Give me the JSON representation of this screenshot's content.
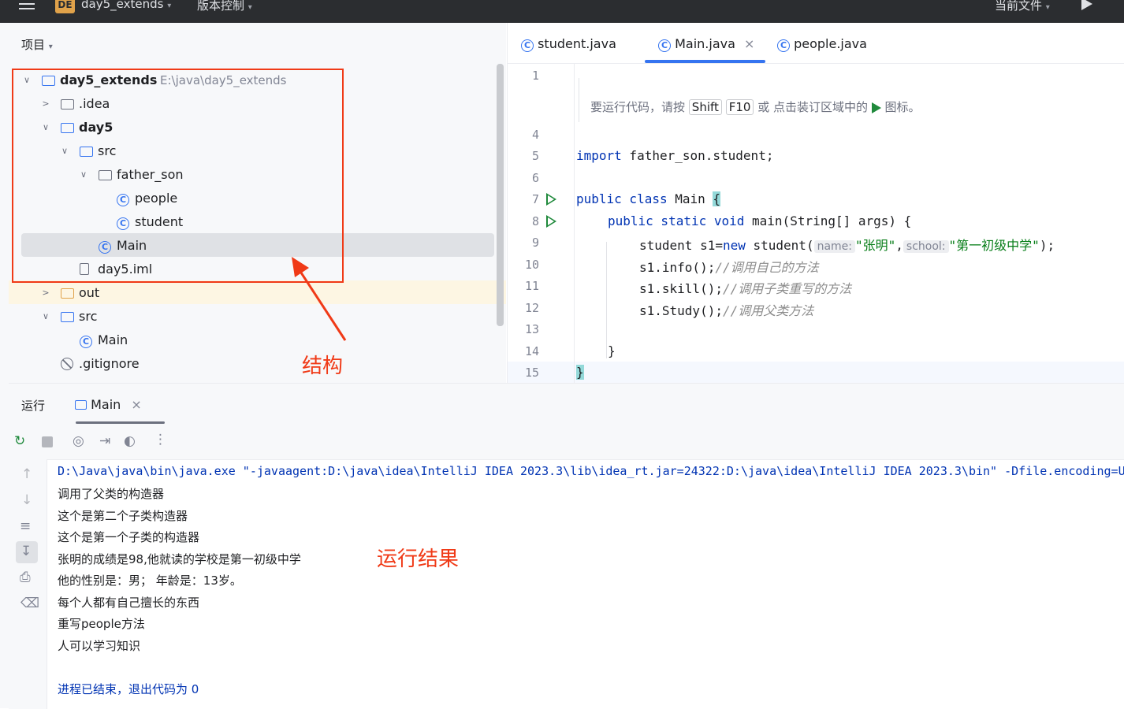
{
  "titlebar": {
    "badge": "DE",
    "project": "day5_extends",
    "vcs": "版本控制",
    "run_config": "当前文件",
    "menu_icon": "hamburger-icon",
    "run_icon": "play-icon"
  },
  "project_panel": {
    "header": "项目",
    "tree": [
      {
        "label": "day5_extends",
        "path": "E:\\java\\day5_extends",
        "expanded": true
      },
      {
        "label": ".idea",
        "expanded": false
      },
      {
        "label": "day5",
        "expanded": true
      },
      {
        "label": "src",
        "expanded": true
      },
      {
        "label": "father_son",
        "expanded": true
      },
      {
        "label": "people"
      },
      {
        "label": "student"
      },
      {
        "label": "Main",
        "selected": true
      },
      {
        "label": "day5.iml"
      },
      {
        "label": "out",
        "expanded": false
      },
      {
        "label": "src",
        "expanded": true
      },
      {
        "label": "Main"
      },
      {
        "label": ".gitignore"
      }
    ]
  },
  "editor": {
    "tabs": [
      {
        "label": "student.java"
      },
      {
        "label": "Main.java",
        "active": true,
        "close": "×"
      },
      {
        "label": "people.java"
      }
    ],
    "hint": {
      "before": "要运行代码，请按",
      "key1": "Shift",
      "key2": "F10",
      "after": "或 点击装订区域中的",
      "tail": "图标。"
    },
    "line_numbers": [
      "1",
      "4",
      "5",
      "6",
      "7",
      "8",
      "9",
      "10",
      "11",
      "12",
      "13",
      "14",
      "15"
    ],
    "code": {
      "import_kw": "import",
      "import_rest": " father_son.student;",
      "l7_kw": "public class",
      "l7_rest": " Main ",
      "brace_open": "{",
      "l8_kw": "public static void",
      "l8_rest": " main(String[] args) {",
      "l9_a": "student s1=",
      "l9_new": "new",
      "l9_b": " student(",
      "l9_hint1": "name:",
      "l9_str1": "\"张明\"",
      "l9_comma": ",",
      "l9_hint2": "school:",
      "l9_str2": "\"第一初级中学\"",
      "l9_end": ");",
      "l10": "s1.info();",
      "l10_cmt": "//调用自己的方法",
      "l11": "s1.skill();",
      "l11_cmt": "//调用子类重写的方法",
      "l12": "s1.Study();",
      "l12_cmt": "//调用父类方法",
      "l14": "}",
      "brace_close": "}"
    }
  },
  "run_panel": {
    "title": "运行",
    "tab": "Main",
    "tab_close": "×",
    "output": [
      "D:\\Java\\java\\bin\\java.exe \"-javaagent:D:\\java\\idea\\IntelliJ IDEA 2023.3\\lib\\idea_rt.jar=24322:D:\\java\\idea\\IntelliJ IDEA 2023.3\\bin\" -Dfile.encoding=UTF-8",
      "调用了父类的构造器",
      "这个是第二个子类构造器",
      "这个是第一个子类的构造器",
      "张明的成绩是98,他就读的学校是第一初级中学",
      "他的性别是：男； 年龄是：13岁。",
      "每个人都有自己擅长的东西",
      "重写people方法",
      "人可以学习知识",
      "",
      "进程已结束，退出代码为  0"
    ]
  },
  "annotations": {
    "structure": "结构",
    "result": "运行结果",
    "color": "#f03a17"
  }
}
